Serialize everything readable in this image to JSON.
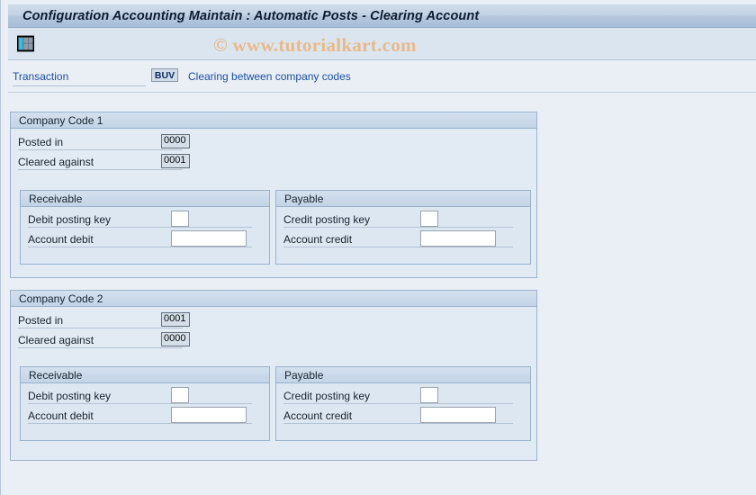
{
  "window": {
    "title": "Configuration Accounting Maintain : Automatic Posts - Clearing Account"
  },
  "toolbar": {
    "grid_icon": "table-grid-icon",
    "watermark": "© www.tutorialkart.com"
  },
  "transaction": {
    "label": "Transaction",
    "code": "BUV",
    "description": "Clearing between company codes"
  },
  "groups": [
    {
      "title": "Company Code 1",
      "fields": [
        {
          "label": "Posted in",
          "value": "0000"
        },
        {
          "label": "Cleared against",
          "value": "0001"
        }
      ],
      "receivable": {
        "title": "Receivable",
        "posting_key_label": "Debit posting key",
        "posting_key_value": "",
        "account_label": "Account debit",
        "account_value": ""
      },
      "payable": {
        "title": "Payable",
        "posting_key_label": "Credit posting key",
        "posting_key_value": "",
        "account_label": "Account credit",
        "account_value": ""
      }
    },
    {
      "title": "Company Code 2",
      "fields": [
        {
          "label": "Posted in",
          "value": "0001"
        },
        {
          "label": "Cleared against",
          "value": "0000"
        }
      ],
      "receivable": {
        "title": "Receivable",
        "posting_key_label": "Debit posting key",
        "posting_key_value": "",
        "account_label": "Account debit",
        "account_value": ""
      },
      "payable": {
        "title": "Payable",
        "posting_key_label": "Credit posting key",
        "posting_key_value": "",
        "account_label": "Account credit",
        "account_value": ""
      }
    }
  ],
  "colors": {
    "page_background": "#eaeff5",
    "titlebar_accent": "#b4c7dd",
    "panel_background": "#e2eaf3",
    "subpanel_background": "#dde7f2",
    "link_text": "#1a4ea8",
    "watermark_text": "#e8b98a",
    "border": "#9ab2cd"
  }
}
